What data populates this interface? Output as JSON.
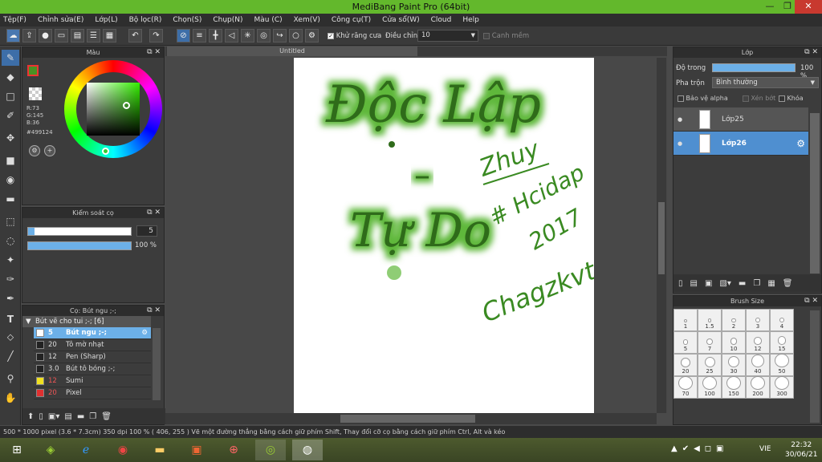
{
  "window": {
    "title": "MediBang Paint Pro (64bit)",
    "minimize": "—",
    "maximize": "❐",
    "close": "✕"
  },
  "menu": [
    "Tệp(F)",
    "Chỉnh sửa(E)",
    "Lớp(L)",
    "Bộ lọc(R)",
    "Chọn(S)",
    "Chụp(N)",
    "Màu (C)",
    "Xem(V)",
    "Công cụ(T)",
    "Cửa sổ(W)",
    "Cloud",
    "Help"
  ],
  "toolbar": {
    "antialias_label": "Khử răng cưa",
    "adjust_label": "Điều chỉnh",
    "adjust_value": "10",
    "snap_label": "Canh mềm"
  },
  "document_tab": "Untitled",
  "color_panel": {
    "title": "Màu",
    "r": "R:73",
    "g": "G:145",
    "b": "B:36",
    "hex": "#499124",
    "accent": "#499124"
  },
  "brush_control": {
    "title": "Kiểm soát cọ",
    "size_value": "5",
    "opacity_value": "100 %",
    "size_fraction": 0.06,
    "opacity_fraction": 1.0
  },
  "brush_panel": {
    "title": "Cọ: Bút ngu ;-;",
    "group": "Bút vẽ cho tui ;-; [6]",
    "items": [
      {
        "size": "5",
        "name": "Bút ngu ;-;",
        "color": "#ffffff",
        "selected": true
      },
      {
        "size": "20",
        "name": "Tô mờ nhạt",
        "color": "#222222",
        "selected": false
      },
      {
        "size": "12",
        "name": "Pen (Sharp)",
        "color": "#222222",
        "selected": false
      },
      {
        "size": "3.0",
        "name": "Bút tô bóng ;-;",
        "color": "#222222",
        "selected": false
      },
      {
        "size": "12",
        "name": "Sumi",
        "color": "#f0e020",
        "selected": false
      },
      {
        "size": "20",
        "name": "Pixel",
        "color": "#e03030",
        "selected": false
      }
    ]
  },
  "layer_panel": {
    "title": "Lớp",
    "opacity_label": "Độ trong",
    "opacity_value": "100 %",
    "blend_label": "Pha trộn",
    "blend_value": "Bình thường",
    "protect_alpha": "Bảo vệ alpha",
    "clipping": "Xén bớt",
    "lock": "Khóa",
    "layers": [
      {
        "name": "Lớp25",
        "selected": false
      },
      {
        "name": "Lớp26",
        "selected": true
      }
    ]
  },
  "brush_size_panel": {
    "title": "Brush Size",
    "sizes": [
      "1",
      "1.5",
      "2",
      "3",
      "4",
      "5",
      "7",
      "10",
      "12",
      "15",
      "20",
      "25",
      "30",
      "40",
      "50",
      "70",
      "100",
      "150",
      "200",
      "300"
    ]
  },
  "artwork": {
    "line1": "Độc Lập",
    "dash": "–",
    "line2": "Tự Do",
    "sig1": "Zhuy",
    "sig2": "# Hcidap",
    "sig3": "2017",
    "sig4": "Chagzkvt",
    "glow_color": "#5fb83a",
    "ink_color": "#2f6b1a"
  },
  "statusbar": "500 * 1000 pixel   (3.6 * 7.3cm)   350 dpi   100 %   ( 406, 255 )   Vẽ một đường thẳng bằng cách giữ phím Shift, Thay đổi cỡ cọ bằng cách giữ phím Ctrl, Alt và kéo",
  "taskbar": {
    "lang": "VIE",
    "time": "22:32",
    "date": "30/06/21"
  }
}
